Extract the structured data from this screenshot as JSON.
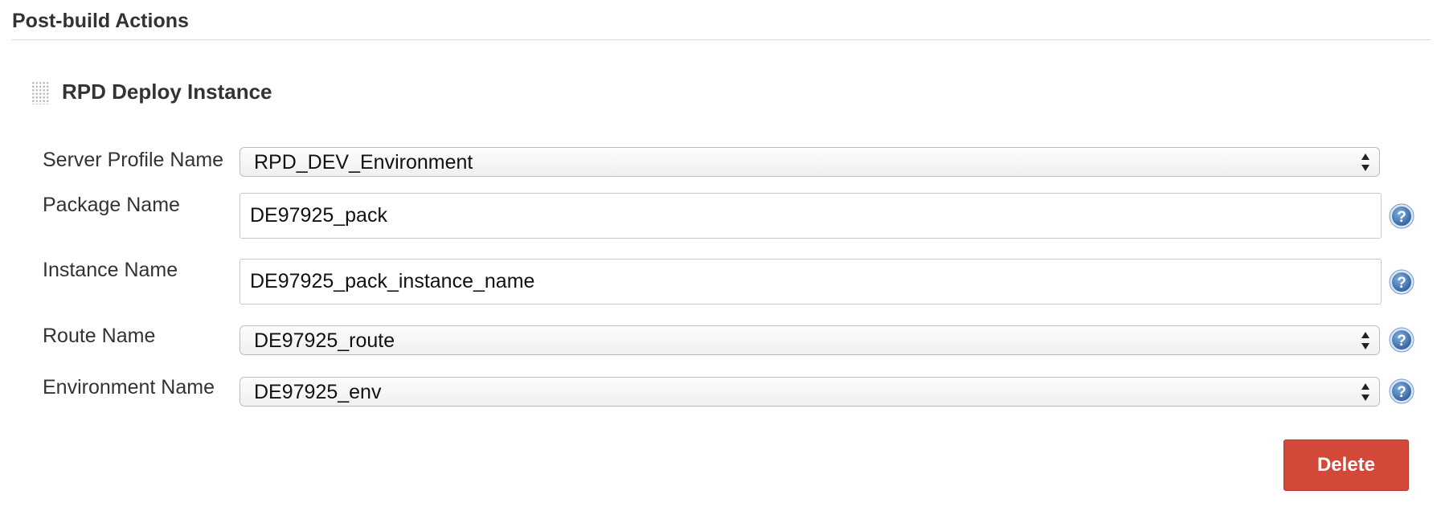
{
  "section": {
    "title": "Post-build Actions"
  },
  "action_block": {
    "title": "RPD Deploy Instance",
    "drag_icon": "drag-handle-icon"
  },
  "fields": {
    "server_profile": {
      "label": "Server Profile Name",
      "value": "RPD_DEV_Environment",
      "type": "select"
    },
    "package_name": {
      "label": "Package Name",
      "value": "DE97925_pack",
      "type": "text"
    },
    "instance_name": {
      "label": "Instance Name",
      "value": "DE97925_pack_instance_name",
      "type": "text"
    },
    "route_name": {
      "label": "Route Name",
      "value": "DE97925_route",
      "type": "select"
    },
    "environment_name": {
      "label": "Environment Name",
      "value": "DE97925_env",
      "type": "select"
    }
  },
  "help_icon": "help-question-icon",
  "buttons": {
    "delete_label": "Delete"
  },
  "colors": {
    "delete_button": "#d24939",
    "help_icon": "#3b6fa8",
    "text": "#333333"
  }
}
